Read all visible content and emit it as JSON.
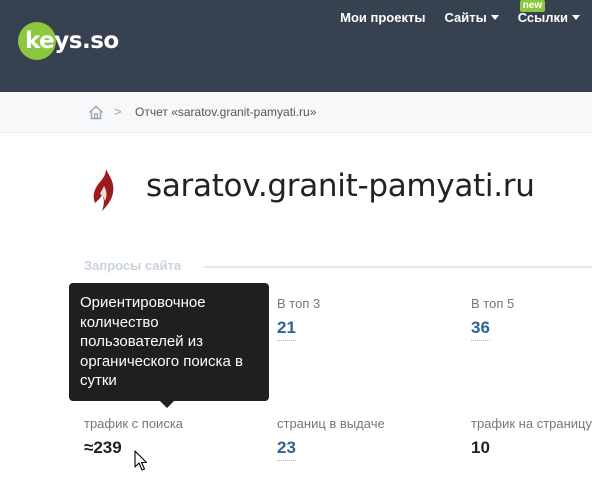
{
  "logo": {
    "text": "keys.so"
  },
  "nav": {
    "items": [
      {
        "label": "Мои проекты",
        "dropdown": false
      },
      {
        "label": "Сайты",
        "dropdown": true
      },
      {
        "label": "Ссылки",
        "dropdown": true,
        "badge": "new"
      }
    ]
  },
  "breadcrumb": {
    "separator": ">",
    "current": "Отчет «saratov.granit-pamyati.ru»"
  },
  "site": {
    "domain": "saratov.granit-pamyati.ru"
  },
  "section": {
    "title": "Запросы сайта"
  },
  "stats": {
    "top3": {
      "label": "В топ 3",
      "value": "21"
    },
    "top5": {
      "label": "В топ 5",
      "value": "36"
    },
    "traffic": {
      "label": "трафик с поиска",
      "value": "≈239"
    },
    "pages": {
      "label": "страниц в выдаче",
      "value": "23"
    },
    "traffic_per_page": {
      "label": "трафик на страницу",
      "value": "10"
    }
  },
  "tooltip": {
    "text": "Ориентировочное количество пользователей из органического поиска в сутки"
  },
  "colors": {
    "header_bg": "#374250",
    "accent_green": "#8dc63f",
    "link_blue": "#2d6495",
    "site_icon_red": "#9b1c1c"
  }
}
